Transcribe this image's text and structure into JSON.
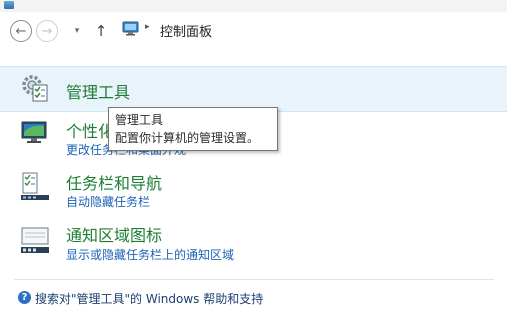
{
  "window": {
    "icon": "control-panel-icon"
  },
  "nav": {
    "back_glyph": "←",
    "forward_glyph": "→",
    "recent_glyph": "▾",
    "up_glyph": "↑",
    "separator_glyph": "▸",
    "breadcrumb": "控制面板"
  },
  "items": [
    {
      "title": "管理工具",
      "description": "",
      "icon": "admin-tools-icon"
    },
    {
      "title": "个性化",
      "description": "更改任务栏和桌面外观",
      "icon": "personalization-icon"
    },
    {
      "title": "任务栏和导航",
      "description": "自动隐藏任务栏",
      "icon": "taskbar-navigation-icon"
    },
    {
      "title": "通知区域图标",
      "description": "显示或隐藏任务栏上的通知区域",
      "icon": "notification-area-icon"
    }
  ],
  "tooltip": {
    "title": "管理工具",
    "text": "配置你计算机的管理设置。"
  },
  "help": {
    "icon": "help-icon",
    "label": "搜索对\"管理工具\"的 Windows 帮助和支持"
  },
  "colors": {
    "title_green": "#1e7d34",
    "link_blue": "#1d62b8",
    "hover_bg": "#e8f3fb"
  }
}
